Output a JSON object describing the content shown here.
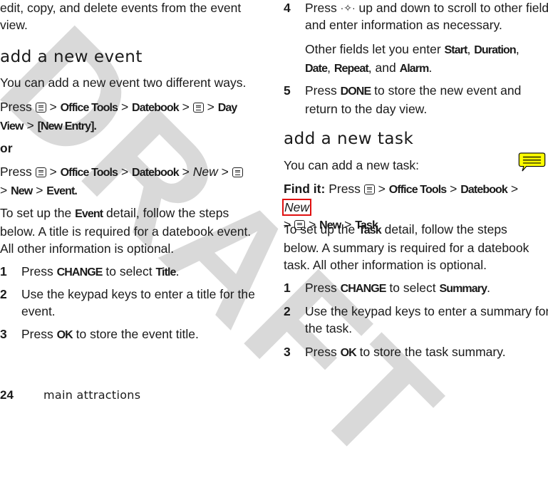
{
  "watermark": "DRAFT",
  "left_column": {
    "intro": "edit, copy, and delete events from the event view.",
    "heading": "add a new event",
    "lead": "You can add a new event two different ways.",
    "path1": {
      "press": "Press",
      "office_tools": "Office Tools",
      "datebook": "Datebook",
      "day_view": "Day View",
      "new_entry": "[New Entry]."
    },
    "or": "or",
    "path2": {
      "press": "Press",
      "office_tools": "Office Tools",
      "datebook": "Datebook",
      "new_italic": "New",
      "new": "New",
      "event": "Event."
    },
    "setup": {
      "pre": "To set up the ",
      "bold": "Event",
      "post": " detail, follow the steps below. A title is required for a datebook event. All other information is optional."
    },
    "steps": [
      {
        "num": "1",
        "pre": "Press ",
        "b1": "CHANGE",
        "mid": " to select ",
        "b2": "Title",
        "post": "."
      },
      {
        "num": "2",
        "text": "Use the keypad keys to enter a title for the event."
      },
      {
        "num": "3",
        "pre": "Press ",
        "b1": "OK",
        "post": " to store the event title."
      }
    ]
  },
  "right_column": {
    "step4": {
      "num": "4",
      "pre": "Press",
      "post": " up and down to scroll to other fields and enter information as necessary."
    },
    "step4_note": {
      "pre": "Other fields let you enter ",
      "f1": "Start",
      "f2": "Duration",
      "f3": "Date",
      "f4": "Repeat",
      "and": ", and ",
      "f5": "Alarm",
      "end": "."
    },
    "step5": {
      "num": "5",
      "pre": "Press ",
      "b1": "DONE",
      "post": " to store the new event and return to the day view."
    },
    "heading": "add a new task",
    "lead": "You can add a new task:",
    "find_it": {
      "label": "Find it:",
      "press": "Press",
      "office_tools": "Office Tools",
      "datebook": "Datebook",
      "new_italic": "New",
      "new": "New",
      "task": "Task"
    },
    "setup": {
      "pre": "To set up the ",
      "bold": "Task",
      "post": " detail, follow the steps below. A summary is required for a datebook task. All other information is optional."
    },
    "steps": [
      {
        "num": "1",
        "pre": "Press ",
        "b1": "CHANGE",
        "mid": " to select ",
        "b2": "Summary",
        "post": "."
      },
      {
        "num": "2",
        "text": "Use the keypad keys to enter a summary for the task."
      },
      {
        "num": "3",
        "pre": "Press ",
        "b1": "OK",
        "post": " to store the task summary."
      }
    ]
  },
  "footer": {
    "page_number": "24",
    "section": "main attractions"
  },
  "annotation": {
    "bubble_color": "#ffff00",
    "highlight_color": "#e01010"
  },
  "sep": ">"
}
